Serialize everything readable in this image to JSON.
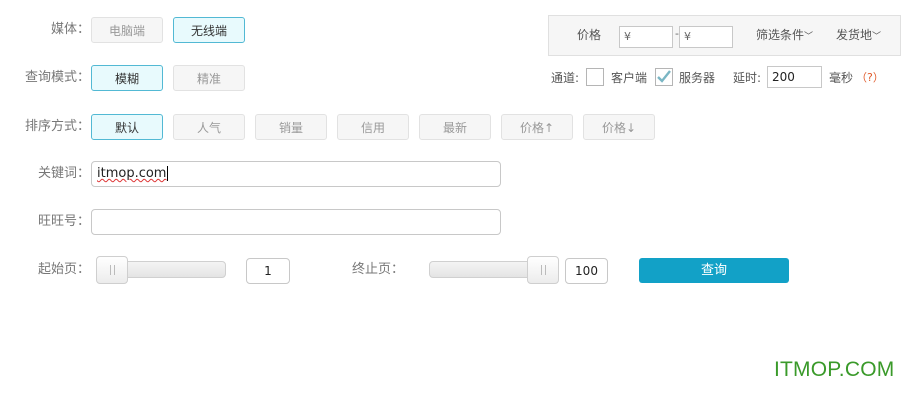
{
  "media": {
    "label": "媒体：",
    "options": [
      "电脑端",
      "无线端"
    ],
    "selected": "无线端"
  },
  "query_mode": {
    "label": "查询模式：",
    "options": [
      "模糊",
      "精准"
    ],
    "selected": "模糊"
  },
  "sort": {
    "label": "排序方式：",
    "options": [
      "默认",
      "人气",
      "销量",
      "信用",
      "最新",
      "价格↑",
      "价格↓"
    ],
    "selected": "默认"
  },
  "keyword": {
    "label": "关键词：",
    "value": "itmop.com"
  },
  "wangwang": {
    "label": "旺旺号：",
    "value": ""
  },
  "start_page": {
    "label": "起始页：",
    "value": "1",
    "slider_fraction": 0.0
  },
  "end_page": {
    "label": "终止页：",
    "value": "100",
    "slider_fraction": 1.0
  },
  "query_button": "查询",
  "filter": {
    "price_label": "价格",
    "price_min_prefix": "¥",
    "price_dash": "-",
    "price_max_prefix": "¥",
    "conditions_label": "筛选条件",
    "ship_from_label": "发货地",
    "chevron": "﹀"
  },
  "channel": {
    "label": "通道:",
    "client_label": "客户端",
    "client_checked": false,
    "server_label": "服务器",
    "server_checked": true,
    "delay_label": "延时:",
    "delay_value": "200",
    "delay_unit": "毫秒",
    "help": "（?）"
  },
  "watermark": "ITMOP.COM",
  "colors": {
    "accent": "#12a1c7",
    "active_bg": "#e8fafd",
    "active_border": "#52b9d4",
    "help": "#e05a2a",
    "watermark": "#3a9a2a"
  }
}
